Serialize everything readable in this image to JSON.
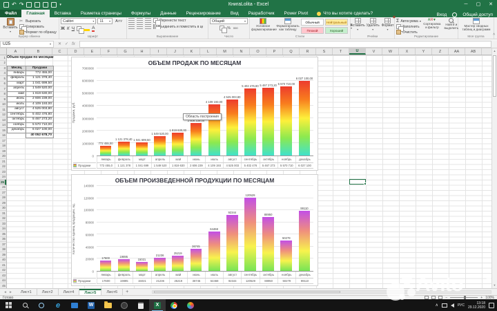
{
  "titlebar": {
    "title": "КнигаLolita - Excel",
    "quick_access": [
      "save",
      "undo",
      "redo",
      "chart",
      "open",
      "print",
      "table"
    ],
    "window_controls": {
      "minimize": "─",
      "maximize": "▢",
      "close": "✕"
    }
  },
  "tabs": {
    "items": [
      {
        "label": "Файл",
        "type": "file"
      },
      {
        "label": "Главная",
        "type": "active"
      },
      {
        "label": "Вставка",
        "type": "normal"
      },
      {
        "label": "Разметка страницы",
        "type": "normal"
      },
      {
        "label": "Формулы",
        "type": "normal"
      },
      {
        "label": "Данные",
        "type": "normal"
      },
      {
        "label": "Рецензирование",
        "type": "normal"
      },
      {
        "label": "Вид",
        "type": "normal"
      },
      {
        "label": "Разработчик",
        "type": "normal"
      },
      {
        "label": "Power Pivot",
        "type": "normal"
      }
    ],
    "tell_me": "Что вы хотите сделать?",
    "signin": "Вход",
    "share": "Общий доступ"
  },
  "ribbon": {
    "clipboard": {
      "label": "Буфер обмена",
      "paste": "Вставить",
      "cut": "Вырезать",
      "copy": "Копировать",
      "format_painter": "Формат по образцу"
    },
    "font": {
      "label": "Шрифт",
      "family": "Calibri",
      "size": "11",
      "bold": "Ж",
      "italic": "К",
      "underline": "Ч",
      "color_letter": "А"
    },
    "alignment": {
      "label": "Выравнивание",
      "wrap": "Перенести текст",
      "merge": "Объединить и поместить в центре"
    },
    "number": {
      "label": "Число",
      "format": "Общий",
      "percent": "%",
      "thousands": "000"
    },
    "styles": {
      "label": "Стили",
      "conditional": "Условное форматирование",
      "format_table": "Форматировать как таблицу",
      "gallery": [
        {
          "label": "Обычный",
          "bg": "#ffffff",
          "fg": "#000000"
        },
        {
          "label": "Нейтральный",
          "bg": "#ffeb9c",
          "fg": "#9c6500"
        },
        {
          "label": "Плохой",
          "bg": "#ffc7ce",
          "fg": "#9c0006"
        },
        {
          "label": "Хороший",
          "bg": "#c6efce",
          "fg": "#276221"
        }
      ]
    },
    "cells": {
      "label": "Ячейки",
      "insert": "Вставить",
      "delete": "Удалить",
      "format": "Формат"
    },
    "editing": {
      "label": "Редактирование",
      "autosum": "Автосумма",
      "fill": "Заполнить",
      "clear": "Очистить",
      "sort": "Сортировка и фильтр",
      "find": "Найти и выделить"
    },
    "my_group": {
      "label": "Моя группа",
      "pivot_wizard": "Мастер сводных таблиц и диаграмм"
    }
  },
  "formula_bar": {
    "name_box": "U25",
    "fx": "fx"
  },
  "grid": {
    "columns": [
      "A",
      "B",
      "C",
      "D",
      "E",
      "F",
      "G",
      "H",
      "I",
      "J",
      "K",
      "L",
      "M",
      "N",
      "O",
      "P",
      "Q",
      "R",
      "S",
      "T",
      "U",
      "V",
      "W",
      "X",
      "Y",
      "Z",
      "AA",
      "AB"
    ],
    "row_count": 45,
    "selected_column": "U",
    "selected_row": 25,
    "selected_cell": "U25"
  },
  "sheet_table": {
    "title": "Объем продаж по месяцам",
    "headers": [
      "Месяц",
      "Продажи"
    ],
    "rows": [
      [
        "январь",
        "772 455,00"
      ],
      [
        "февраль",
        "1 121 378,40"
      ],
      [
        "март",
        "1 041 699,50"
      ],
      [
        "апрель",
        "1 549 520,00"
      ],
      [
        "май",
        "1 819 630,00"
      ],
      [
        "июнь",
        "2 606 239,00"
      ],
      [
        "июль",
        "4 109 193,00"
      ],
      [
        "август",
        "4 525 003,80"
      ],
      [
        "сентябрь",
        "5 402 476,80"
      ],
      [
        "октябрь",
        "5 467 273,20"
      ],
      [
        "ноябрь",
        "5 570 710,00"
      ],
      [
        "декабрь",
        "6 027 100,00"
      ]
    ],
    "total": "40 052 678,70"
  },
  "tooltip": "Область построения",
  "chart_data": [
    {
      "type": "bar",
      "title": "ОБЪЕМ ПРОДАЖ ПО МЕСЯЦАМ",
      "ylabel": "Продажи, руб.",
      "xlabel": "",
      "legend": "Продажи",
      "legend_position": "table-left",
      "grid": true,
      "categories": [
        "январь",
        "февраль",
        "март",
        "апрель",
        "май",
        "июнь",
        "июль",
        "август",
        "сентябрь",
        "октябрь",
        "ноябрь",
        "декабрь"
      ],
      "values": [
        772455.0,
        1121378.4,
        1041699.5,
        1549520,
        1819630,
        2606239,
        4109193,
        4525003.8,
        5402476.8,
        5467273.2,
        5570710,
        6027100
      ],
      "bar_labels": [
        "772 455,00",
        "1 121 378,40",
        "1 041 699,50",
        "1 549 520,00",
        "1 819 630,00",
        "2 606 239,00",
        "4 109 193,00",
        "4 525 003,80",
        "5 402 476,80",
        "5 467 273,20",
        "5 570 710,00",
        "6 027 100,00"
      ],
      "table_values": [
        "772 455,0",
        "1 121 378",
        "1 041 699",
        "1 549 520",
        "1 819 630",
        "2 606 239",
        "4 109 193",
        "4 525 003",
        "5 402 476",
        "5 467 273",
        "5 570 710",
        "6 027 100"
      ],
      "ylim": [
        0,
        7000000
      ],
      "ytick_step": 1000000,
      "bar_gradient": [
        "#ed3c2d",
        "#f87d1e",
        "#fdf03b",
        "#8ce94f",
        "#40e2cc"
      ]
    },
    {
      "type": "bar",
      "title": "ОБЪЕМ ПРОИЗВЕДЕННОЙ ПРОДУКЦИИ ПО МЕСЯЦАМ",
      "ylabel": "Количество единиц продукции, ед.",
      "xlabel": "",
      "legend": "Продажи",
      "legend_position": "table-left",
      "grid": true,
      "categories": [
        "январь",
        "февраль",
        "март",
        "апрель",
        "май",
        "июнь",
        "июль",
        "август",
        "сентябрь",
        "октябрь",
        "ноябрь",
        "декабрь"
      ],
      "values": [
        17600,
        19895,
        15021,
        21236,
        25219,
        36745,
        64468,
        92344,
        120529,
        88950,
        50279,
        99110
      ],
      "bar_labels": [
        "17600",
        "19895",
        "15021",
        "21236",
        "25219",
        "36745",
        "64468",
        "92344",
        "120529",
        "88950",
        "50279",
        "99110"
      ],
      "table_values": [
        "17600",
        "19895",
        "15021",
        "21236",
        "25219",
        "36745",
        "64468",
        "92344",
        "120529",
        "88950",
        "50279",
        "99110"
      ],
      "ylim": [
        0,
        140000
      ],
      "ytick_step": 20000,
      "bar_gradient": [
        "#c24fe6",
        "#ef8f7d",
        "#f8f34d",
        "#77e455"
      ]
    }
  ],
  "sheet_tabs": {
    "items": [
      "Лист1",
      "Лист2",
      "Лист4",
      "Лист5",
      "Лист6"
    ],
    "active": "Лист5",
    "add_label": "+"
  },
  "status_bar": {
    "ready": "Готово",
    "zoom": "100%"
  },
  "taskbar": {
    "icons": [
      "start",
      "search",
      "cortana",
      "edge",
      "mail",
      "app-blue",
      "file-explorer",
      "app-dark",
      "calculator",
      "excel",
      "chrome",
      "app-colorful"
    ],
    "active_icon": "excel",
    "tray": {
      "lang": "РУС",
      "time": "13:18",
      "date": "29.12.2020"
    }
  },
  "watermark": {
    "text": "Avito"
  },
  "colors": {
    "excel_green": "#217346",
    "ribbon_bg": "#f1f1f1",
    "selection": "#217346"
  }
}
